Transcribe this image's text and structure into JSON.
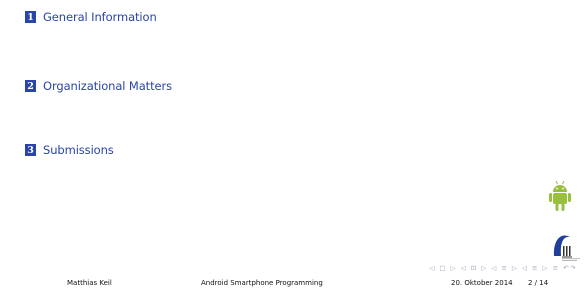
{
  "toc": [
    {
      "number": "1",
      "label": "General Information"
    },
    {
      "number": "2",
      "label": "Organizational Matters"
    },
    {
      "number": "3",
      "label": "Submissions"
    }
  ],
  "footer": {
    "author": "Matthias Keil",
    "title": "Android Smartphone Programming",
    "date": "20. Oktober 2014",
    "page": "2 / 14"
  },
  "nav_symbols": "◁ □ ▷ ◁ ⊡ ▷ ◁ ≡ ▷ ◁ ≡ ▷ ≡ ↶↷",
  "colors": {
    "accent": "#2a45a8",
    "android_green": "#97c03c",
    "logo_blue": "#1f3f9a"
  },
  "icons": [
    "android-logo-icon",
    "university-logo-icon"
  ]
}
